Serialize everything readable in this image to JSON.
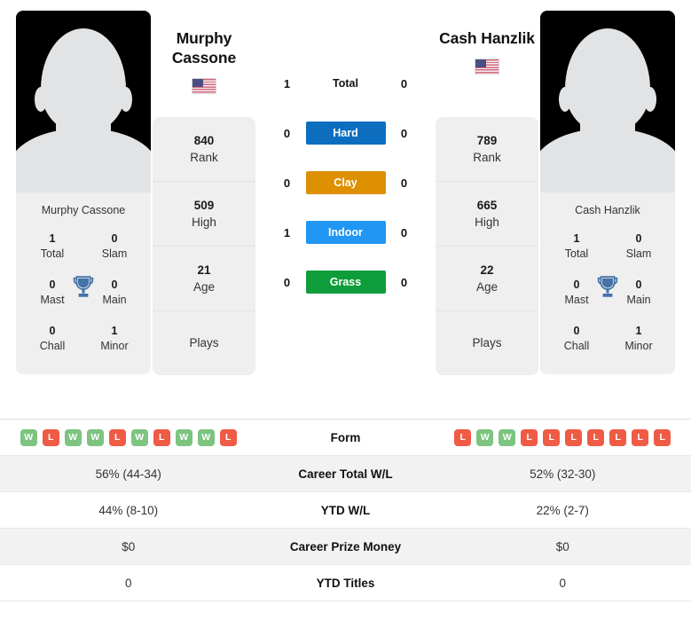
{
  "colors": {
    "hard": "#0d6ebf",
    "clay": "#dd9000",
    "indoor": "#2196f3",
    "grass": "#0f9d3c",
    "win": "#7cc47f",
    "loss": "#ef5b45",
    "trophy": "#4572a7"
  },
  "left": {
    "name": "Murphy Cassone",
    "name_line1": "Murphy",
    "name_line2": "Cassone",
    "country": "USA",
    "flag": "us-flag-icon",
    "titles": [
      {
        "value": "1",
        "label": "Total"
      },
      {
        "value": "0",
        "label": "Slam"
      },
      {
        "value": "0",
        "label": "Mast"
      },
      {
        "value": "0",
        "label": "Main"
      },
      {
        "value": "0",
        "label": "Chall"
      },
      {
        "value": "1",
        "label": "Minor"
      }
    ],
    "stats": [
      {
        "value": "840",
        "label": "Rank"
      },
      {
        "value": "509",
        "label": "High"
      },
      {
        "value": "21",
        "label": "Age"
      },
      {
        "value": "",
        "label": "Plays"
      }
    ],
    "surface_counts": {
      "total": "1",
      "hard": "0",
      "clay": "0",
      "indoor": "1",
      "grass": "0"
    },
    "form": [
      "W",
      "L",
      "W",
      "W",
      "L",
      "W",
      "L",
      "W",
      "W",
      "L"
    ],
    "career_total_wl": "56% (44-34)",
    "ytd_wl": "44% (8-10)",
    "career_prize_money": "$0",
    "ytd_titles": "0"
  },
  "right": {
    "name": "Cash Hanzlik",
    "name_line1": "Cash Hanzlik",
    "name_line2": "",
    "country": "USA",
    "flag": "us-flag-icon",
    "titles": [
      {
        "value": "1",
        "label": "Total"
      },
      {
        "value": "0",
        "label": "Slam"
      },
      {
        "value": "0",
        "label": "Mast"
      },
      {
        "value": "0",
        "label": "Main"
      },
      {
        "value": "0",
        "label": "Chall"
      },
      {
        "value": "1",
        "label": "Minor"
      }
    ],
    "stats": [
      {
        "value": "789",
        "label": "Rank"
      },
      {
        "value": "665",
        "label": "High"
      },
      {
        "value": "22",
        "label": "Age"
      },
      {
        "value": "",
        "label": "Plays"
      }
    ],
    "surface_counts": {
      "total": "0",
      "hard": "0",
      "clay": "0",
      "indoor": "0",
      "grass": "0"
    },
    "form": [
      "L",
      "W",
      "W",
      "L",
      "L",
      "L",
      "L",
      "L",
      "L",
      "L"
    ],
    "career_total_wl": "52% (32-30)",
    "ytd_wl": "22% (2-7)",
    "career_prize_money": "$0",
    "ytd_titles": "0"
  },
  "surfaces": [
    {
      "key": "total",
      "label": "Total"
    },
    {
      "key": "hard",
      "label": "Hard"
    },
    {
      "key": "clay",
      "label": "Clay"
    },
    {
      "key": "indoor",
      "label": "Indoor"
    },
    {
      "key": "grass",
      "label": "Grass"
    }
  ],
  "table_labels": {
    "form": "Form",
    "career_total_wl": "Career Total W/L",
    "ytd_wl": "YTD W/L",
    "career_prize_money": "Career Prize Money",
    "ytd_titles": "YTD Titles"
  }
}
